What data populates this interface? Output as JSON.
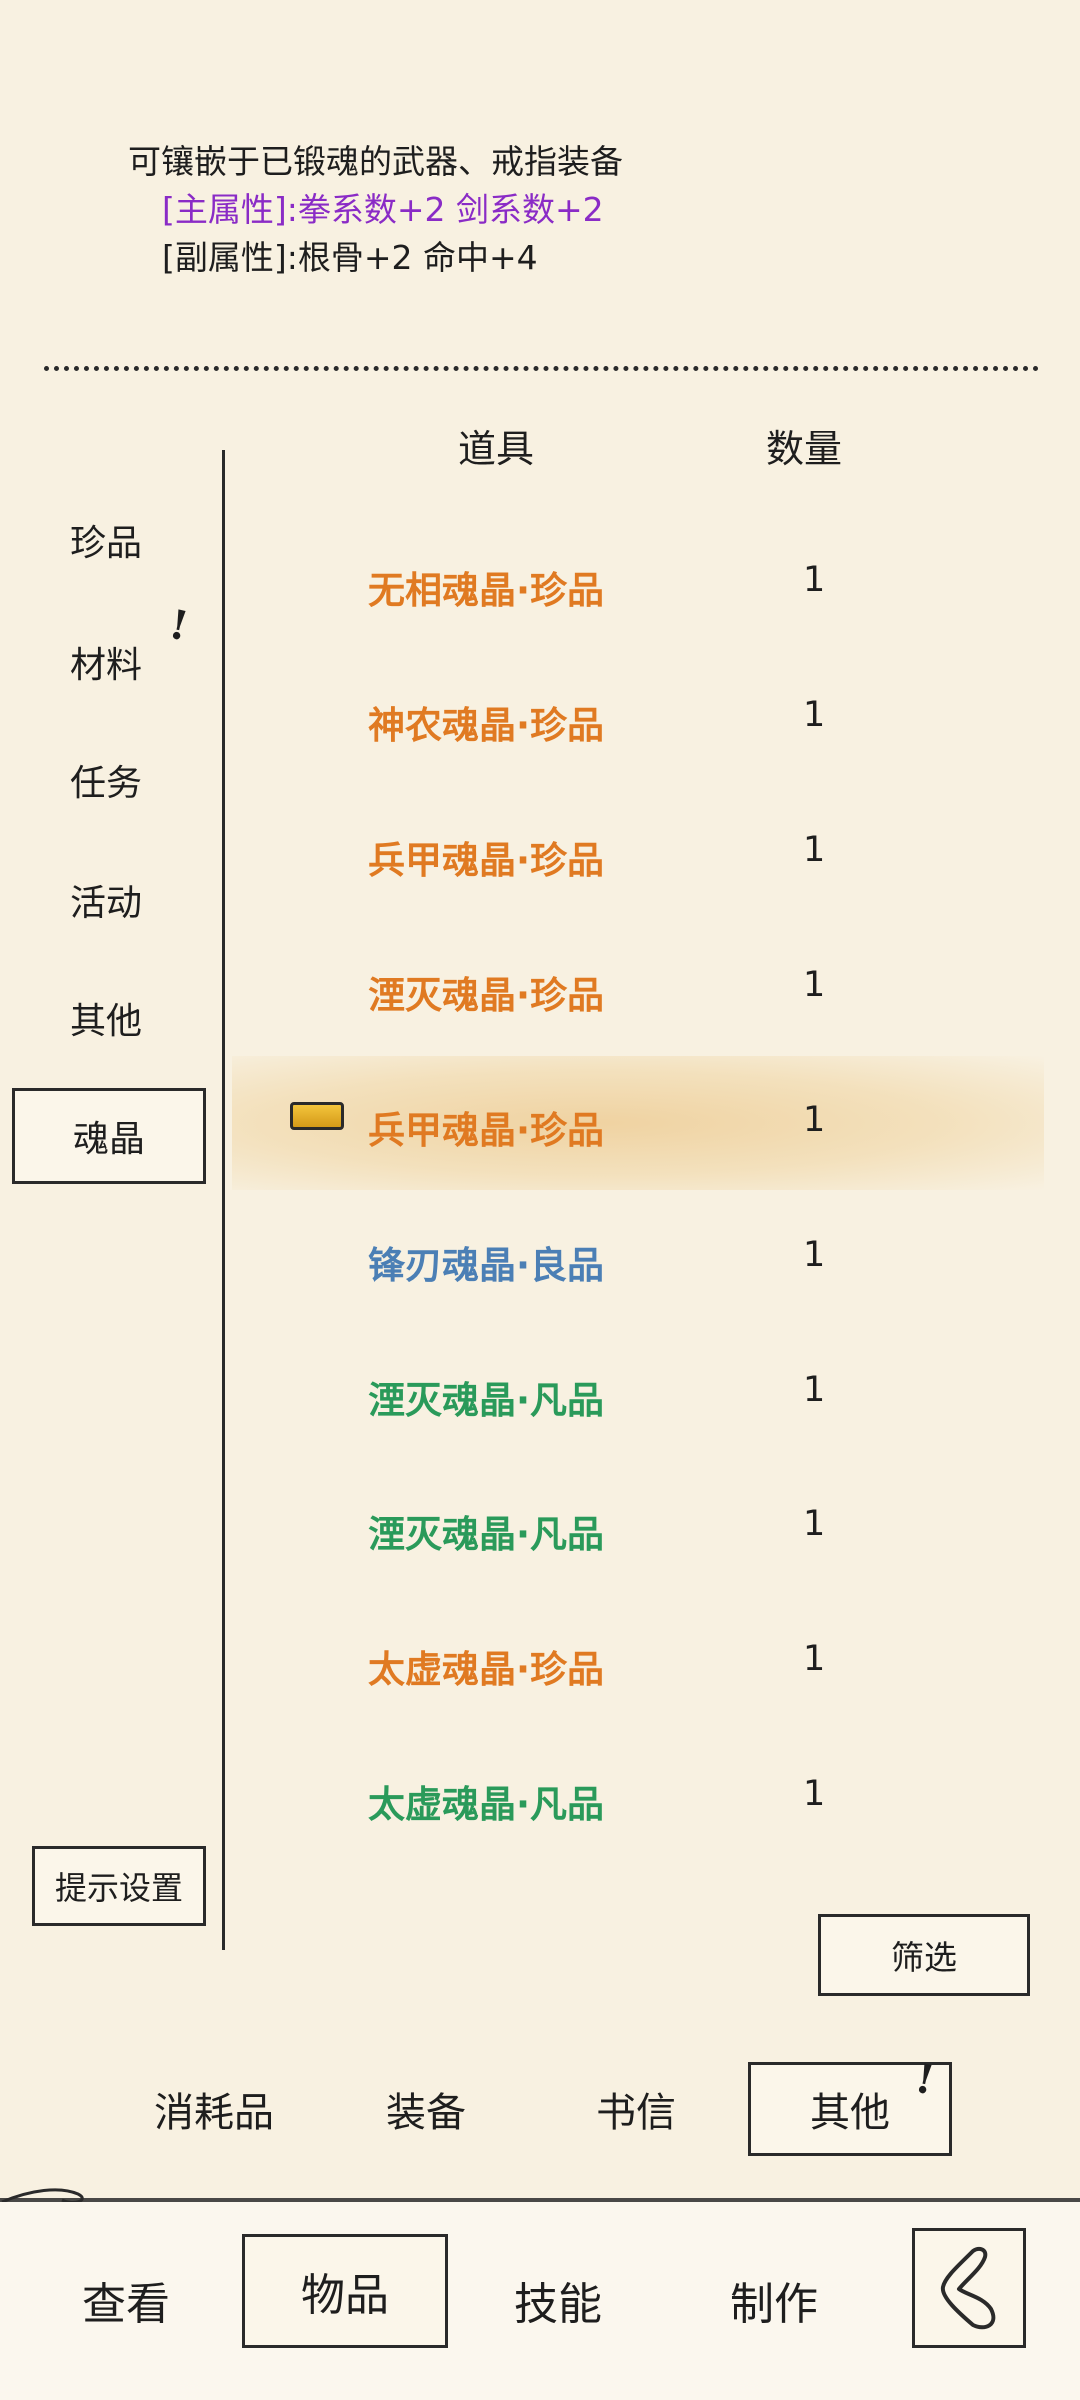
{
  "item_detail": {
    "line1": "可镶嵌于已锻魂的武器、戒指装备",
    "main_attr": "[主属性]:拳系数+2 剑系数+2",
    "sub_attr": "[副属性]:根骨+2 命中+4"
  },
  "table_header": {
    "item": "道具",
    "quantity": "数量"
  },
  "categories": [
    {
      "label": "珍品"
    },
    {
      "label": "材料",
      "alert": "!"
    },
    {
      "label": "任务"
    },
    {
      "label": "活动"
    },
    {
      "label": "其他"
    },
    {
      "label": "魂晶",
      "selected": true
    }
  ],
  "items": [
    {
      "name": "无相魂晶·珍品",
      "qty": "1",
      "quality": "zhen"
    },
    {
      "name": "神农魂晶·珍品",
      "qty": "1",
      "quality": "zhen"
    },
    {
      "name": "兵甲魂晶·珍品",
      "qty": "1",
      "quality": "zhen"
    },
    {
      "name": "湮灭魂晶·珍品",
      "qty": "1",
      "quality": "zhen"
    },
    {
      "name": "兵甲魂晶·珍品",
      "qty": "1",
      "quality": "zhen",
      "equipped": true
    },
    {
      "name": "锋刃魂晶·良品",
      "qty": "1",
      "quality": "liang"
    },
    {
      "name": "湮灭魂晶·凡品",
      "qty": "1",
      "quality": "fan"
    },
    {
      "name": "湮灭魂晶·凡品",
      "qty": "1",
      "quality": "fan"
    },
    {
      "name": "太虚魂晶·珍品",
      "qty": "1",
      "quality": "zhen"
    },
    {
      "name": "太虚魂晶·凡品",
      "qty": "1",
      "quality": "fan"
    }
  ],
  "hint_settings_label": "提示设置",
  "filter_label": "筛选",
  "sub_tabs": {
    "consumables": "消耗品",
    "equipment": "装备",
    "letters": "书信",
    "other": "其他",
    "other_alert": "!"
  },
  "nav_tabs": {
    "view": "查看",
    "items": "物品",
    "skills": "技能",
    "craft": "制作"
  },
  "colors": {
    "background": "#f8f1e1",
    "quality_zhen": "#e07a22",
    "quality_liang": "#4b7fb5",
    "quality_fan": "#2a9a5a",
    "main_attr": "#8a2bc6"
  },
  "icons": {
    "equipped": "equipped-badge-icon",
    "back": "back-arrow-icon"
  }
}
